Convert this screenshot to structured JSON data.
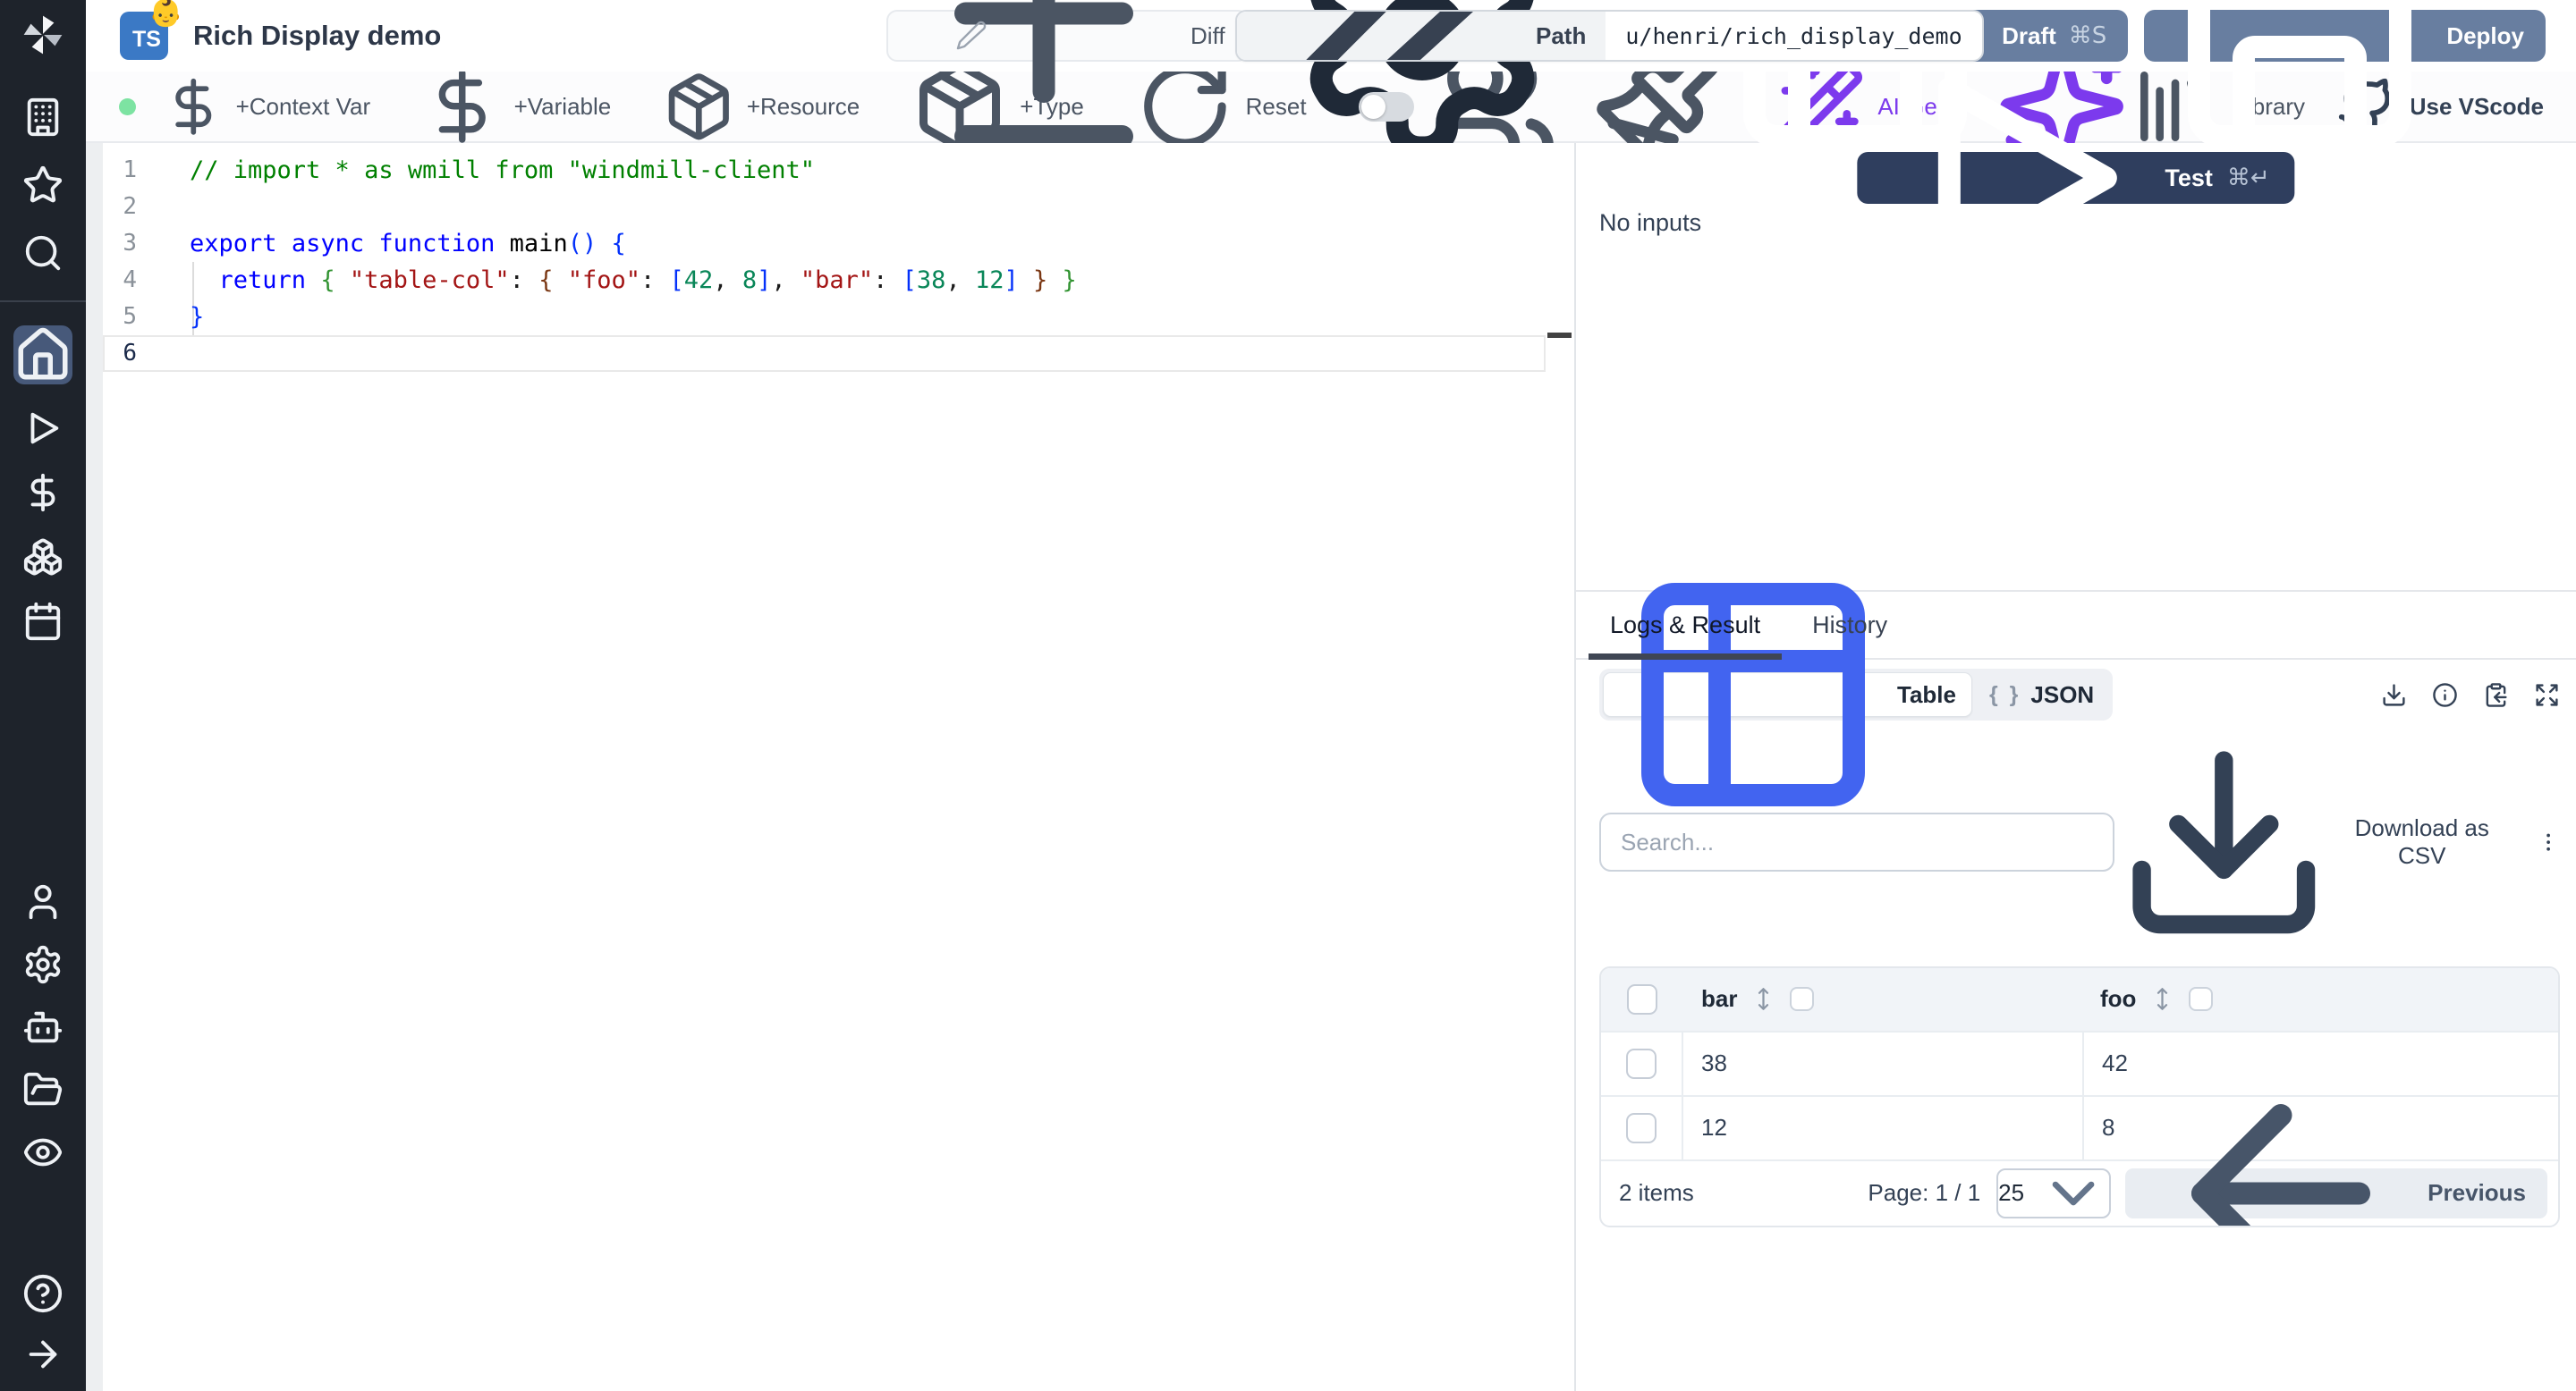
{
  "header": {
    "title": "Rich Display demo",
    "language_badge": "TS",
    "badge_emoji": "👶",
    "path": {
      "label": "Path",
      "value": "u/henri/rich_display_demo"
    },
    "buttons": {
      "diff": "Diff",
      "diff_icon": "diff",
      "settings": "Settings",
      "settings_icon": "settings",
      "draft": "Draft",
      "draft_shortcut": "⌘S",
      "draft_icon": "save",
      "deploy": "Deploy",
      "deploy_icon": "save"
    }
  },
  "toolbar": {
    "status_color": "#7de3a2",
    "context_var": {
      "label": "+Context Var",
      "icon": "dollar-sign"
    },
    "variable": {
      "label": "+Variable",
      "icon": "dollar-sign"
    },
    "resource": {
      "label": "+Resource",
      "icon": "package"
    },
    "type": {
      "label": "+Type",
      "icon": "package"
    },
    "reset": {
      "label": "Reset",
      "icon": "rotate-cw"
    },
    "multiplayer_icon": "users",
    "format_icon": "paintbrush",
    "ai_gen": {
      "label": "AI Gen",
      "icon": "wand-sparkles",
      "color": "#7c3aed"
    },
    "ai_sparkles_icon": "sparkles",
    "library": {
      "label": "Library",
      "icon": "library"
    },
    "use_vscode": {
      "label": "Use VScode",
      "icon": "github"
    }
  },
  "sidebar": {
    "top": [
      "building",
      "star",
      "search"
    ],
    "main": [
      "home",
      "play",
      "dollar-sign",
      "boxes",
      "calendar"
    ],
    "active": "home",
    "admin": [
      "user",
      "settings",
      "bot",
      "folder-open",
      "eye"
    ],
    "bottom": [
      "help-circle",
      "arrow-right"
    ]
  },
  "editor": {
    "active_line": 6,
    "lines": [
      [
        [
          "comment",
          "// import * as wmill from \"windmill-client\""
        ]
      ],
      [],
      [
        [
          "kw",
          "export"
        ],
        [
          "pl",
          " "
        ],
        [
          "kw",
          "async"
        ],
        [
          "pl",
          " "
        ],
        [
          "kw",
          "function"
        ],
        [
          "pl",
          " "
        ],
        [
          "fn",
          "main"
        ],
        [
          "b1",
          "()"
        ],
        [
          "pl",
          " "
        ],
        [
          "b1",
          "{"
        ]
      ],
      [
        [
          "pl",
          "  "
        ],
        [
          "kw",
          "return"
        ],
        [
          "pl",
          " "
        ],
        [
          "b2",
          "{"
        ],
        [
          "pl",
          " "
        ],
        [
          "str",
          "\"table-col\""
        ],
        [
          "pl",
          ": "
        ],
        [
          "b3",
          "{"
        ],
        [
          "pl",
          " "
        ],
        [
          "str",
          "\"foo\""
        ],
        [
          "pl",
          ": "
        ],
        [
          "b1",
          "["
        ],
        [
          "num",
          "42"
        ],
        [
          "pl",
          ", "
        ],
        [
          "num",
          "8"
        ],
        [
          "b1",
          "]"
        ],
        [
          "pl",
          ", "
        ],
        [
          "str",
          "\"bar\""
        ],
        [
          "pl",
          ": "
        ],
        [
          "b1",
          "["
        ],
        [
          "num",
          "38"
        ],
        [
          "pl",
          ", "
        ],
        [
          "num",
          "12"
        ],
        [
          "b1",
          "]"
        ],
        [
          "pl",
          " "
        ],
        [
          "b3",
          "}"
        ],
        [
          "pl",
          " "
        ],
        [
          "b2",
          "}"
        ]
      ],
      [
        [
          "b1",
          "}"
        ]
      ],
      []
    ]
  },
  "run": {
    "test": "Test",
    "shortcut": "⌘↵",
    "no_inputs": "No inputs"
  },
  "result": {
    "tabs": {
      "logs": "Logs & Result",
      "history": "History"
    },
    "active_tab": "Logs & Result",
    "views": {
      "table": "Table",
      "json": "JSON",
      "json_glyph": "{ }"
    },
    "active_view": "Table",
    "actions": [
      "download",
      "info",
      "clipboard-copy",
      "expand"
    ],
    "search_placeholder": "Search...",
    "download_csv": "Download as CSV",
    "table": {
      "columns": [
        "bar",
        "foo"
      ],
      "rows": [
        [
          "38",
          "42"
        ],
        [
          "12",
          "8"
        ]
      ]
    },
    "footer": {
      "count": "2 items",
      "page": "Page: 1 / 1",
      "page_size": "25",
      "previous": "Previous"
    }
  }
}
